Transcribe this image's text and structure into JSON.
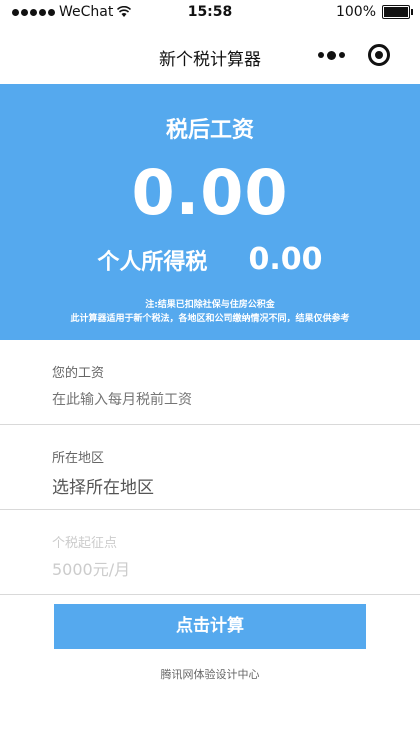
{
  "status_bar": {
    "carrier": "WeChat",
    "time": "15:58",
    "battery": "100%",
    "battery_level": 1.0
  },
  "nav": {
    "title": "新个税计算器",
    "more_icon": "more-dots-icon",
    "close_icon": "target-close-icon"
  },
  "result": {
    "label": "税后工资",
    "amount": "0.00",
    "tax_label": "个人所得税",
    "tax_value": "0.00",
    "note1": "注:结果已扣除社保与住房公积金",
    "note2": "此计算器适用于新个税法，各地区和公司缴纳情况不同，结果仅供参考"
  },
  "form": {
    "salary_label": "您的工资",
    "salary_placeholder": "在此输入每月税前工资",
    "region_label": "所在地区",
    "region_value": "选择所在地区",
    "threshold_label": "个税起征点",
    "threshold_value": "5000元/月"
  },
  "action": {
    "button_label": "点击计算"
  },
  "footer": {
    "text": "腾讯网体验设计中心"
  },
  "colors": {
    "accent": "#55a9ee"
  }
}
